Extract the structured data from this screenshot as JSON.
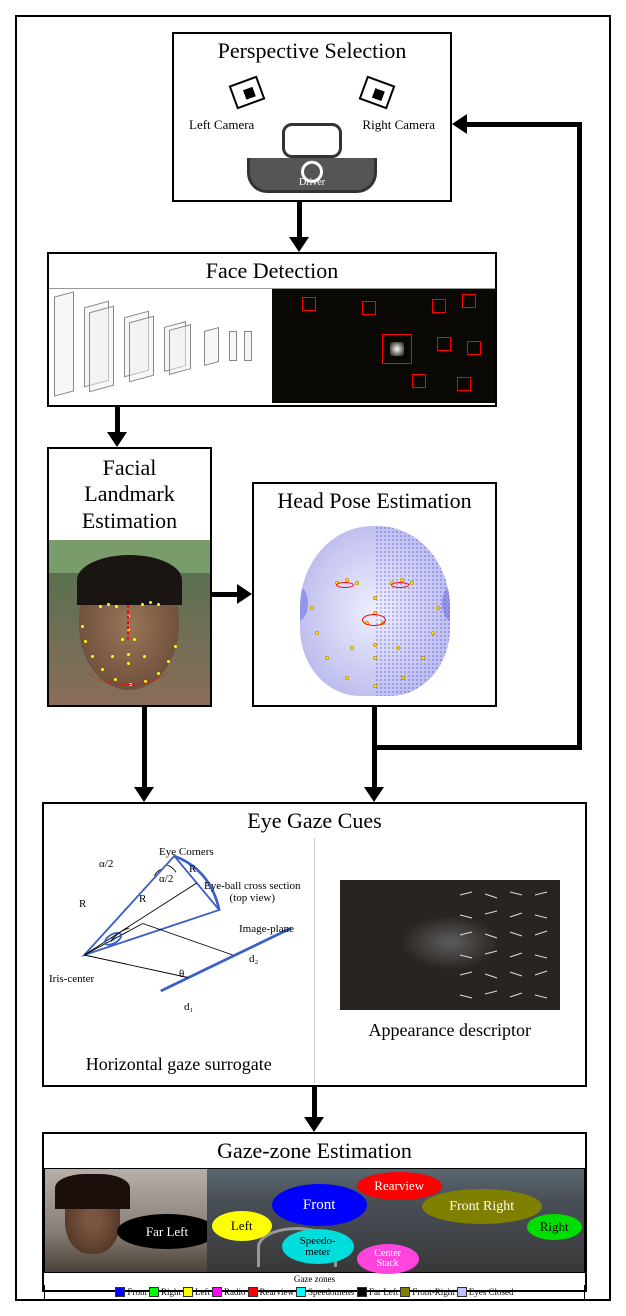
{
  "boxes": {
    "perspective": {
      "title": "Perspective Selection",
      "left_camera": "Left\nCamera",
      "right_camera": "Right\nCamera",
      "driver": "Driver"
    },
    "face_detection": {
      "title": "Face Detection"
    },
    "landmark": {
      "title": "Facial Landmark Estimation"
    },
    "headpose": {
      "title": "Head Pose Estimation"
    },
    "eyegaze": {
      "title": "Eye Gaze Cues",
      "left_caption": "Horizontal gaze surrogate",
      "right_caption": "Appearance descriptor",
      "labels": {
        "eye_corners": "Eye Corners",
        "iris_center": "Iris-center",
        "image_plane": "Image-plane",
        "cross_section": "Eye-ball cross section\n(top view)",
        "alpha": "α/2",
        "alpha2": "α/2",
        "theta": "θ",
        "R1": "R",
        "R2": "R",
        "R3": "R",
        "d1": "d₁",
        "d2": "d₂"
      }
    },
    "gazezone": {
      "title": "Gaze-zone Estimation",
      "zones": {
        "far_left": "Far Left",
        "left": "Left",
        "front": "Front",
        "rearview": "Rearview",
        "front_right": "Front Right",
        "right": "Right",
        "speedometer": "Speedo-\nmeter",
        "center_stack": "Center\nStack"
      },
      "legend_title": "Gaze zones",
      "legend": [
        {
          "color": "#0000FF",
          "label": "Front"
        },
        {
          "color": "#00FF00",
          "label": "Right"
        },
        {
          "color": "#FFFF00",
          "label": "Left"
        },
        {
          "color": "#FF00FF",
          "label": "Radio"
        },
        {
          "color": "#FF0000",
          "label": "Rearview"
        },
        {
          "color": "#00FFFF",
          "label": "Speedometer"
        },
        {
          "color": "#000000",
          "label": "Far Left"
        },
        {
          "color": "#808000",
          "label": "Front-Right"
        },
        {
          "color": "#C0C0FF",
          "label": "Eyes Closed"
        }
      ]
    }
  }
}
